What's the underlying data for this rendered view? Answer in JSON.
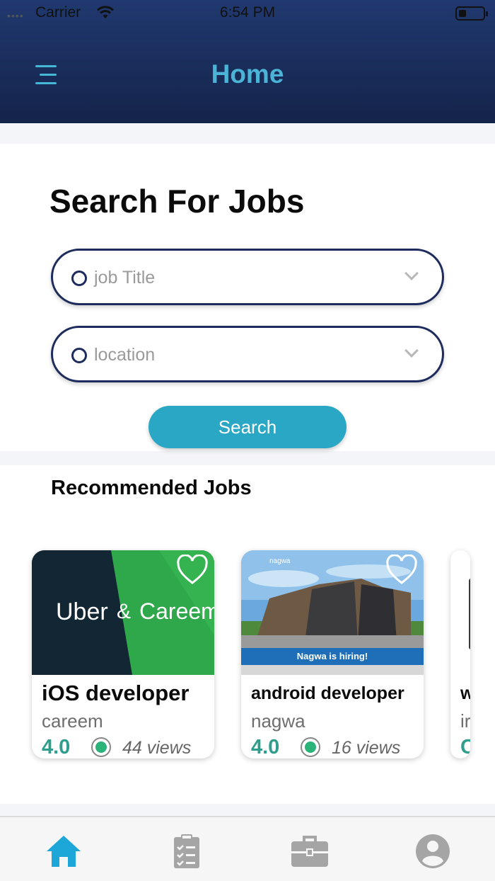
{
  "status": {
    "carrier": "Carrier",
    "time": "6:54 PM"
  },
  "header": {
    "title": "Home",
    "menu_icon": "hamburger-menu-icon"
  },
  "search": {
    "heading": "Search For Jobs",
    "job_title_placeholder": "job Title",
    "location_placeholder": "location",
    "button_label": "Search"
  },
  "recommended": {
    "heading": "Recommended Jobs",
    "jobs": [
      {
        "title": "iOS developer",
        "company": "careem",
        "rating": "4.0",
        "views": "44 views",
        "image_text_left": "Uber",
        "image_text_amp": "&",
        "image_text_right": "Careem"
      },
      {
        "title": "android developer",
        "company": "nagwa",
        "rating": "4.0",
        "views": "16 views",
        "image_brand": "nagwa",
        "image_banner": "Nagwa is hiring!"
      },
      {
        "title": "w",
        "company": "ir",
        "rating": "C"
      }
    ]
  },
  "tabbar": {
    "tabs": [
      "home",
      "tasks",
      "jobs",
      "profile"
    ],
    "active": "home",
    "active_color": "#1da7d9",
    "inactive_color": "#a5a5a5"
  },
  "colors": {
    "header": "#1b2f5e",
    "accent": "#4ab3d6",
    "button": "#2aa7c4",
    "rating": "#2f9e8c"
  }
}
